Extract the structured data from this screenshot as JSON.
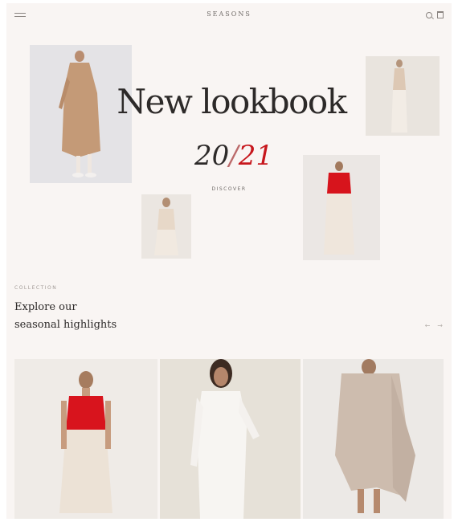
{
  "header": {
    "brand": "SEASONS"
  },
  "hero": {
    "title": "New lookbook",
    "year_left": "20",
    "year_slash": "/",
    "year_right": "21",
    "cta": "Discover"
  },
  "highlights": {
    "eyebrow": "Collection",
    "title_line1": "Explore our",
    "title_line2": "seasonal highlights",
    "prev_label": "←",
    "next_label": "→"
  },
  "colors": {
    "background": "#f9f5f3",
    "accent_red": "#c7171d",
    "text_dark": "#2d2a29"
  }
}
